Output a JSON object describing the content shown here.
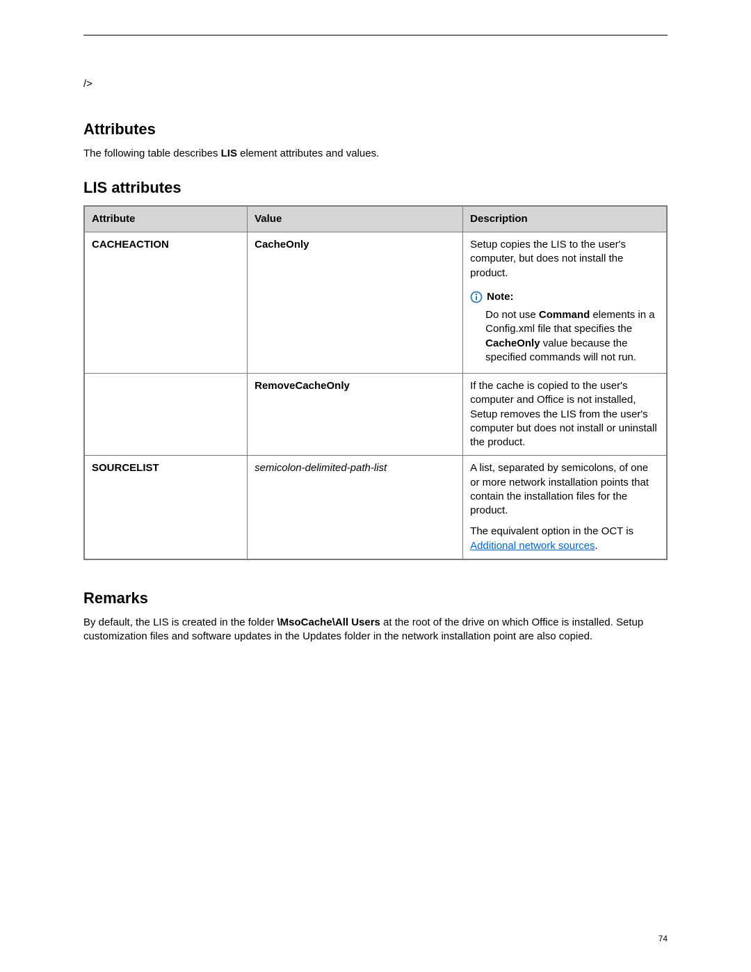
{
  "code_fragment": "/>",
  "section1": {
    "heading": "Attributes",
    "intro_pre": "The following table describes ",
    "intro_bold": "LIS",
    "intro_post": " element attributes and values."
  },
  "section2": {
    "heading": "LIS attributes"
  },
  "table": {
    "headers": {
      "attr": "Attribute",
      "val": "Value",
      "desc": "Description"
    },
    "row1": {
      "attr": "CACHEACTION",
      "val": "CacheOnly",
      "desc_main": "Setup copies the LIS to the user's computer, but does not install the product.",
      "note_label": "Note:",
      "note_p1a": "Do not use ",
      "note_p1b": "Command",
      "note_p1c": " elements in a Config.xml file that specifies the ",
      "note_p1d": "CacheOnly",
      "note_p1e": " value because the specified commands will not run."
    },
    "row2": {
      "attr": "",
      "val": "RemoveCacheOnly",
      "desc": "If the cache is copied to the user's computer and Office is not installed, Setup removes the LIS from the user's computer but does not install or uninstall the product."
    },
    "row3": {
      "attr": "SOURCELIST",
      "val": "semicolon-delimited-path-list",
      "desc_p1": "A list, separated by semicolons, of one or more network installation points that contain the installation files for the product.",
      "desc_p2a": "The equivalent option in the OCT is ",
      "desc_link": "Additional network sources",
      "desc_p2b": "."
    }
  },
  "remarks": {
    "heading": "Remarks",
    "p_a": "By default, the LIS is created in the folder ",
    "p_bold": "\\MsoCache\\All Users",
    "p_b": " at the root of the drive on which Office is installed. Setup customization files and software updates in the Updates folder in the network installation point are also copied."
  },
  "page_number": "74"
}
